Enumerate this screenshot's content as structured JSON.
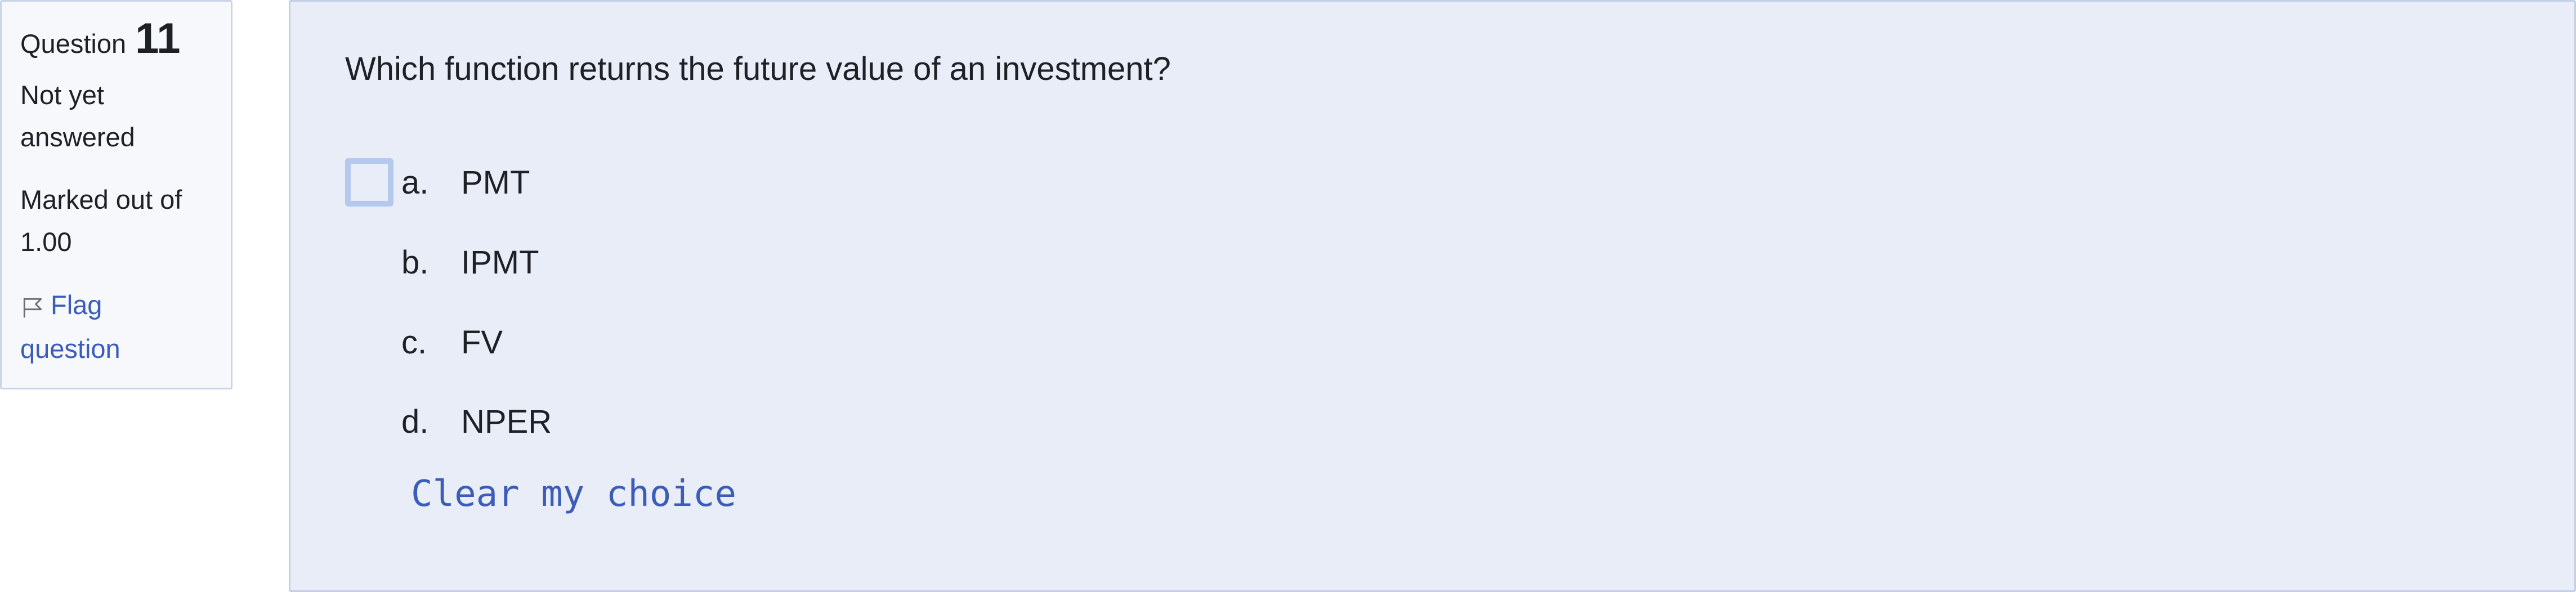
{
  "question_info": {
    "question_label": "Question",
    "question_number": "11",
    "state": "Not yet answered",
    "state_line1": "Not yet",
    "state_line2": "answered",
    "grade_line1": "Marked out of",
    "grade_line2": "1.00",
    "flag_line1": "Flag",
    "flag_line2": "question",
    "flag_icon": "flag-outline-icon"
  },
  "question": {
    "text": "Which function returns the future value of an investment?",
    "answers": [
      {
        "letter": "a.",
        "label": "PMT"
      },
      {
        "letter": "b.",
        "label": "IPMT"
      },
      {
        "letter": "c.",
        "label": "FV"
      },
      {
        "letter": "d.",
        "label": "NPER"
      }
    ],
    "clear_label": "Clear my choice"
  },
  "colors": {
    "link": "#3b5cb8",
    "content_bg": "#e9edf7",
    "info_bg": "#f7f8fb",
    "focus_ring": "#b5c8ee"
  }
}
